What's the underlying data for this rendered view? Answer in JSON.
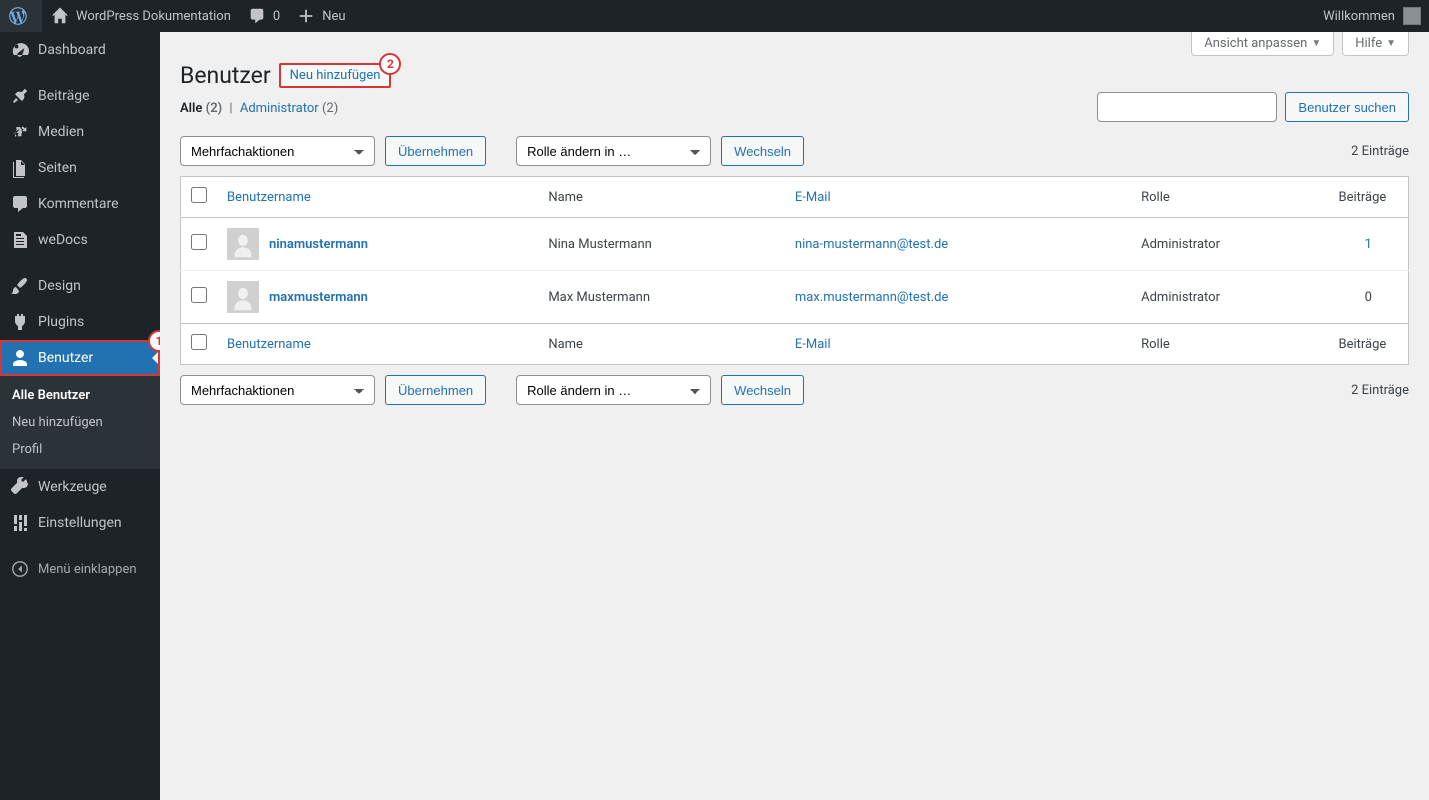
{
  "adminbar": {
    "site_title": "WordPress Dokumentation",
    "comments_count": "0",
    "new_label": "Neu",
    "welcome": "Willkommen"
  },
  "sidebar": {
    "items": [
      {
        "id": "dashboard",
        "label": "Dashboard"
      },
      {
        "id": "posts",
        "label": "Beiträge"
      },
      {
        "id": "media",
        "label": "Medien"
      },
      {
        "id": "pages",
        "label": "Seiten"
      },
      {
        "id": "comments",
        "label": "Kommentare"
      },
      {
        "id": "wedocs",
        "label": "weDocs"
      },
      {
        "id": "design",
        "label": "Design"
      },
      {
        "id": "plugins",
        "label": "Plugins"
      },
      {
        "id": "users",
        "label": "Benutzer"
      },
      {
        "id": "tools",
        "label": "Werkzeuge"
      },
      {
        "id": "settings",
        "label": "Einstellungen"
      }
    ],
    "users_submenu": [
      {
        "id": "all",
        "label": "Alle Benutzer",
        "current": true
      },
      {
        "id": "add",
        "label": "Neu hinzufügen"
      },
      {
        "id": "profile",
        "label": "Profil"
      }
    ],
    "collapse": "Menü einklappen"
  },
  "screen_meta": {
    "options": "Ansicht anpassen",
    "help": "Hilfe"
  },
  "page": {
    "title": "Benutzer",
    "add_new": "Neu hinzufügen"
  },
  "filters": {
    "all_label": "Alle",
    "all_count": "(2)",
    "admin_label": "Administrator",
    "admin_count": "(2)"
  },
  "search": {
    "button": "Benutzer suchen"
  },
  "bulk": {
    "actions_placeholder": "Mehrfachaktionen",
    "apply": "Übernehmen",
    "role_placeholder": "Rolle ändern in …",
    "change": "Wechseln"
  },
  "count_label": "2 Einträge",
  "columns": {
    "username": "Benutzername",
    "name": "Name",
    "email": "E-Mail",
    "role": "Rolle",
    "posts": "Beiträge"
  },
  "users": [
    {
      "username": "ninamustermann",
      "name": "Nina Mustermann",
      "email": "nina-mustermann@test.de",
      "role": "Administrator",
      "posts": "1",
      "posts_link": true
    },
    {
      "username": "maxmustermann",
      "name": "Max Mustermann",
      "email": "max.mustermann@test.de",
      "role": "Administrator",
      "posts": "0",
      "posts_link": false
    }
  ],
  "annotations": {
    "sidebar_num": "1",
    "addnew_num": "2"
  }
}
